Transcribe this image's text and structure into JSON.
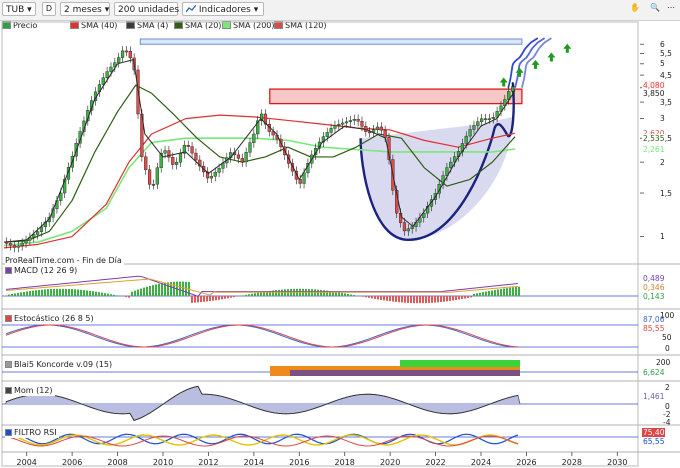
{
  "toolbar": {
    "symbol": "TUB",
    "period_icon": "D",
    "range": "2 meses",
    "units": "200 unidades",
    "indicators": "Indicadores"
  },
  "legend": [
    {
      "label": "Precio",
      "color": "#2ea043"
    },
    {
      "label": "SMA (40)",
      "color": "#e03030"
    },
    {
      "label": "SMA (4)",
      "color": "#3a3a3a"
    },
    {
      "label": "SMA (20)",
      "color": "#2f5d15"
    },
    {
      "label": "SMA (200)",
      "color": "#79e879"
    },
    {
      "label": "SMA (120)",
      "color": "#d94a4a"
    }
  ],
  "source_note": "ProRealTime.com - Fin de Día",
  "panels": {
    "macd": {
      "label": "MACD (12 26 9)",
      "values": [
        "0,489",
        "0,346",
        "0,143"
      ]
    },
    "stoch": {
      "label": "Estocástico (26 8 5)",
      "values": [
        "87,06",
        "85,55"
      ],
      "ticks": [
        "100",
        "50",
        "0"
      ]
    },
    "konc": {
      "label": "Blai5 Koncorde v.09 (15)",
      "values": [
        "6,624"
      ],
      "ticks": [
        "200"
      ]
    },
    "mom": {
      "label": "Mom (12)",
      "values": [
        "1,461"
      ],
      "ticks": [
        "2",
        "0",
        "-2",
        "-4"
      ]
    },
    "rsi": {
      "label": "FILTRO RSI",
      "values": [
        "75,40",
        "65,55"
      ]
    }
  },
  "chart_data": {
    "type": "line",
    "scale": "log",
    "ylim": [
      0.85,
      6.6
    ],
    "xlim": [
      2003.0,
      2031.0
    ],
    "y_ticks": [
      "6",
      "5,5",
      "5",
      "4,5",
      "4",
      "3,5",
      "3",
      "2,5",
      "2",
      "1,5",
      "1"
    ],
    "y_tick_values": [
      6,
      5.5,
      5,
      4.5,
      4,
      3.5,
      3,
      2.5,
      2,
      1.5,
      1
    ],
    "x_ticks": [
      "2004",
      "2006",
      "2008",
      "2010",
      "2012",
      "2014",
      "2016",
      "2018",
      "2020",
      "2022",
      "2024",
      "2026",
      "2028",
      "2030"
    ],
    "x_tick_values": [
      2004,
      2006,
      2008,
      2010,
      2012,
      2014,
      2016,
      2018,
      2020,
      2022,
      2024,
      2026,
      2028,
      2030
    ],
    "price_labels": [
      {
        "text": "4,080",
        "value": 4.08
      },
      {
        "text": "3,850",
        "value": 3.85
      },
      {
        "text": "2,620",
        "value": 2.62
      },
      {
        "text": "2,535",
        "value": 2.535
      },
      {
        "text": "2,261",
        "value": 2.261
      }
    ],
    "price": {
      "name": "Precio",
      "x": [
        2003.0,
        2003.5,
        2004.0,
        2004.5,
        2005.0,
        2005.5,
        2006.0,
        2006.5,
        2007.0,
        2007.5,
        2008.0,
        2008.3,
        2008.7,
        2009.0,
        2009.5,
        2010.0,
        2010.5,
        2011.0,
        2011.5,
        2012.0,
        2012.5,
        2013.0,
        2013.5,
        2014.0,
        2014.3,
        2014.6,
        2015.0,
        2015.5,
        2016.0,
        2016.5,
        2017.0,
        2017.5,
        2018.0,
        2018.5,
        2019.0,
        2019.5,
        2019.8,
        2020.2,
        2020.6,
        2021.0,
        2021.5,
        2022.0,
        2022.5,
        2023.0,
        2023.5,
        2024.0,
        2024.5,
        2025.0,
        2025.3,
        2025.5
      ],
      "values": [
        0.95,
        0.9,
        0.97,
        1.05,
        1.2,
        1.5,
        2.1,
        2.9,
        3.8,
        4.6,
        5.2,
        5.8,
        5.0,
        2.2,
        1.5,
        2.3,
        1.9,
        2.4,
        2.0,
        1.7,
        1.9,
        2.2,
        2.0,
        2.6,
        3.2,
        2.7,
        2.5,
        2.0,
        1.6,
        2.1,
        2.5,
        2.8,
        2.9,
        3.0,
        2.6,
        2.8,
        2.5,
        1.3,
        1.05,
        1.1,
        1.25,
        1.5,
        1.9,
        2.2,
        2.7,
        3.0,
        3.0,
        3.5,
        4.0,
        4.08
      ]
    },
    "sma_short": {
      "name": "SMA (4)",
      "x": [
        2003.0,
        2004.0,
        2005.0,
        2006.0,
        2007.0,
        2008.0,
        2008.7,
        2009.2,
        2010.0,
        2011.0,
        2012.0,
        2013.0,
        2014.3,
        2015.0,
        2016.0,
        2017.0,
        2018.0,
        2019.0,
        2019.8,
        2020.5,
        2021.0,
        2022.0,
        2023.0,
        2024.0,
        2024.7,
        2025.5
      ],
      "values": [
        0.95,
        0.97,
        1.18,
        2.0,
        3.6,
        5.0,
        5.2,
        2.6,
        2.1,
        2.2,
        1.8,
        2.1,
        3.0,
        2.6,
        1.7,
        2.4,
        2.8,
        2.7,
        2.5,
        1.2,
        1.1,
        1.45,
        2.1,
        2.8,
        3.0,
        3.9
      ]
    },
    "sma20": {
      "name": "SMA (20)",
      "x": [
        2003.0,
        2004.0,
        2005.0,
        2006.0,
        2007.0,
        2008.0,
        2008.8,
        2009.5,
        2010.5,
        2011.5,
        2012.5,
        2013.5,
        2014.5,
        2015.5,
        2016.5,
        2017.5,
        2018.5,
        2019.5,
        2020.5,
        2021.5,
        2022.5,
        2023.5,
        2024.5,
        2025.5
      ],
      "values": [
        0.95,
        0.96,
        1.05,
        1.4,
        2.2,
        3.2,
        4.1,
        3.8,
        3.1,
        2.5,
        2.1,
        2.0,
        2.1,
        2.3,
        2.1,
        2.1,
        2.3,
        2.6,
        2.5,
        1.9,
        1.6,
        1.7,
        2.0,
        2.535
      ]
    },
    "sma200": {
      "name": "SMA (200)",
      "x": [
        2003.0,
        2004.5,
        2006.0,
        2007.5,
        2008.5,
        2009.5,
        2011.0,
        2012.5,
        2014.0,
        2015.5,
        2017.0,
        2018.5,
        2020.0,
        2021.5,
        2023.0,
        2024.5,
        2025.5
      ],
      "values": [
        0.92,
        0.95,
        1.05,
        1.3,
        1.9,
        2.4,
        2.5,
        2.5,
        2.5,
        2.45,
        2.3,
        2.25,
        2.2,
        2.2,
        2.2,
        2.2,
        2.261
      ]
    },
    "sma40": {
      "name": "SMA (40)",
      "x": [
        2003.0,
        2004.5,
        2006.0,
        2007.5,
        2008.5,
        2009.5,
        2011.0,
        2012.5,
        2014.0,
        2015.5,
        2017.0,
        2018.5,
        2020.0,
        2021.5,
        2023.0,
        2024.5,
        2025.5
      ],
      "values": [
        0.9,
        0.93,
        1.0,
        1.35,
        2.0,
        2.6,
        3.0,
        3.1,
        3.05,
        2.95,
        2.85,
        2.75,
        2.7,
        2.45,
        2.3,
        2.5,
        2.62
      ]
    },
    "rect_top": [
      2009.0,
      2025.8,
      6.0,
      6.3
    ],
    "rect_red": [
      2014.7,
      2025.8,
      3.45,
      3.95
    ],
    "cup_bottom_value": 0.97,
    "arrows": [
      {
        "x": 2025.0,
        "value": 4.2
      },
      {
        "x": 2025.7,
        "value": 4.6
      },
      {
        "x": 2026.4,
        "value": 4.95
      },
      {
        "x": 2027.1,
        "value": 5.3
      },
      {
        "x": 2027.8,
        "value": 5.75
      }
    ]
  }
}
